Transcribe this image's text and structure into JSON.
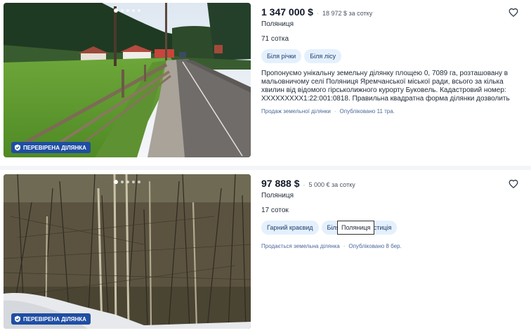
{
  "listings": [
    {
      "price": "1 347 000 $",
      "price_per_unit": "18 972 $ за сотку",
      "location": "Поляниця",
      "area": "71 сотка",
      "tags": [
        "Біля річки",
        "Біля лісу"
      ],
      "description": "Пропонуємо унікальну земельну ділянку площею 0, 7089 га, розташовану в мальовничому селі Поляниця Яремчанської міської ради, всього за кілька хвилин від відомого гірськолижного курорту Буковель. Кадастровий номер: XXXXXXXXX1:22:001:0818. Правильна квадратна форма ділянки дозволить її...",
      "category": "Продаж земельної ділянки",
      "published": "Опубліковано 11 тра.",
      "verified_badge": "ПЕРЕВІРЕНА ДІЛЯНКА",
      "favorite_icon": "heart-outline-icon"
    },
    {
      "price": "97 888 $",
      "price_per_unit": "5 000 € за сотку",
      "location": "Поляниця",
      "area": "17 соток",
      "tags": [
        "Гарний краєвид",
        "Біля",
        "а інвестиція"
      ],
      "category": "Продається земельна ділянка",
      "published": "Опубліковано 8 бер.",
      "verified_badge": "ПЕРЕВІРЕНА ДІЛЯНКА",
      "favorite_icon": "heart-outline-icon"
    }
  ],
  "tooltip": "Поляниця",
  "separator": "·",
  "colors": {
    "tag_bg": "#e4f0fc",
    "tag_text": "#1f3d6e",
    "badge_bg": "#1f4ea3",
    "meta_text": "#4b6a99"
  }
}
